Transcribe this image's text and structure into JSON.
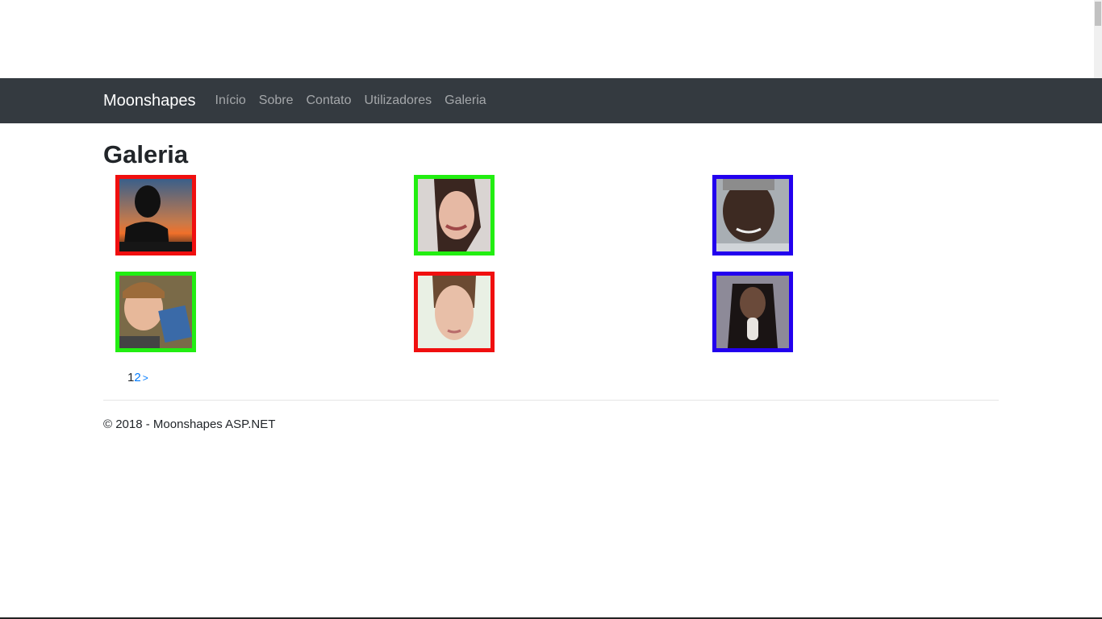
{
  "navbar": {
    "brand": "Moonshapes",
    "links": [
      "Início",
      "Sobre",
      "Contato",
      "Utilizadores",
      "Galeria"
    ]
  },
  "page": {
    "title": "Galeria"
  },
  "gallery": {
    "border_colors": [
      "#f00f0f",
      "#22ee11",
      "#2200ee",
      "#22ee11",
      "#f00f0f",
      "#2200ee"
    ]
  },
  "pager": {
    "current": "1",
    "next_page": "2",
    "next_arrow": ">"
  },
  "footer": {
    "text": "© 2018 - Moonshapes ASP.NET"
  }
}
